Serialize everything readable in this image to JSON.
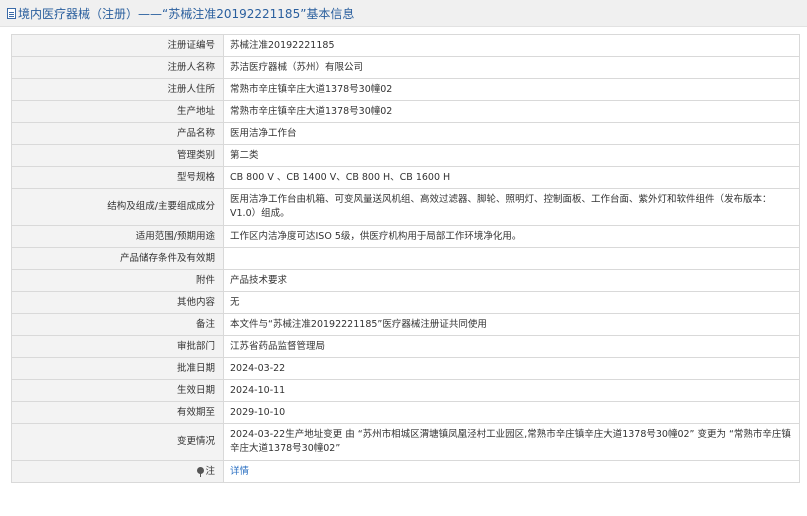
{
  "header": {
    "title": "境内医疗器械（注册）——“苏械注准20192221185”基本信息",
    "icon": "document-icon"
  },
  "rows": [
    {
      "label": "注册证编号",
      "value": "苏械注准20192221185"
    },
    {
      "label": "注册人名称",
      "value": "苏洁医疗器械（苏州）有限公司"
    },
    {
      "label": "注册人住所",
      "value": "常熟市辛庄镇辛庄大道1378号30幢02"
    },
    {
      "label": "生产地址",
      "value": "常熟市辛庄镇辛庄大道1378号30幢02"
    },
    {
      "label": "产品名称",
      "value": "医用洁净工作台"
    },
    {
      "label": "管理类别",
      "value": "第二类"
    },
    {
      "label": "型号规格",
      "value": "CB 800 V 、CB 1400 V、CB 800 H、CB 1600 H"
    },
    {
      "label": "结构及组成/主要组成成分",
      "value": "医用洁净工作台由机箱、可变风量送风机组、高效过滤器、脚轮、照明灯、控制面板、工作台面、紫外灯和软件组件（发布版本：V1.0）组成。"
    },
    {
      "label": "适用范围/预期用途",
      "value": "工作区内洁净度可达ISO 5级，供医疗机构用于局部工作环境净化用。"
    },
    {
      "label": "产品储存条件及有效期",
      "value": ""
    },
    {
      "label": "附件",
      "value": "产品技术要求"
    },
    {
      "label": "其他内容",
      "value": "无"
    },
    {
      "label": "备注",
      "value": "本文件与“苏械注准20192221185”医疗器械注册证共同使用"
    },
    {
      "label": "审批部门",
      "value": "江苏省药品监督管理局"
    },
    {
      "label": "批准日期",
      "value": "2024-03-22"
    },
    {
      "label": "生效日期",
      "value": "2024-10-11"
    },
    {
      "label": "有效期至",
      "value": "2029-10-10"
    },
    {
      "label": "变更情况",
      "value": "2024-03-22生产地址变更 由 “苏州市相城区渭塘镇凤凰泾村工业园区,常熟市辛庄镇辛庄大道1378号30幢02” 变更为 “常熟市辛庄镇辛庄大道1378号30幢02”"
    }
  ],
  "note_row": {
    "label": "注",
    "icon": "pin-icon",
    "link_text": "详情",
    "link_color": "#2a6fc2"
  }
}
